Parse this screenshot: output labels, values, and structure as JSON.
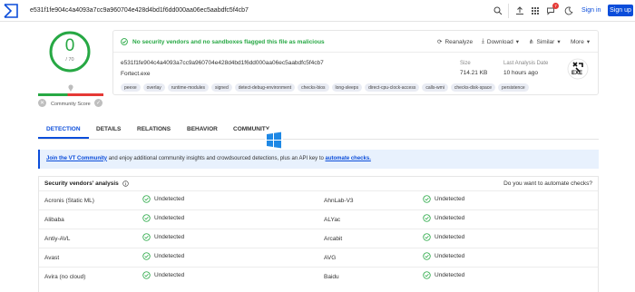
{
  "topbar": {
    "search_value": "e531f1fe904c4a4093a7cc9a960704e428d4bd1f6dd000aa06ec5aabdfc5f4cb7",
    "signin_label": "Sign in",
    "signup_label": "Sign up",
    "notification_count": "7"
  },
  "score": {
    "detected": "0",
    "total": "/ 70",
    "label": "Community Score"
  },
  "summary": {
    "status": "No security vendors and no sandboxes flagged this file as malicious",
    "actions": {
      "reanalyze": "Reanalyze",
      "download": "Download",
      "similar": "Similar",
      "more": "More"
    },
    "hash": "e531f1fe904c4a4093a7cc9a960704e428d4bd1f6dd000aa06ec5aabdfc5f4cb7",
    "filename": "Fortect.exe",
    "tags": [
      "peexe",
      "overlay",
      "runtime-modules",
      "signed",
      "detect-debug-environment",
      "checks-bios",
      "long-sleeps",
      "direct-cpu-clock-access",
      "calls-wmi",
      "checks-disk-space",
      "persistence"
    ],
    "size_label": "Size",
    "size_value": "714.21 KB",
    "last_analysis_label": "Last Analysis Date",
    "last_analysis_value": "10 hours ago",
    "file_type": "EXE"
  },
  "tabs": [
    "DETECTION",
    "DETAILS",
    "RELATIONS",
    "BEHAVIOR",
    "COMMUNITY"
  ],
  "banner": {
    "link1": "Join the VT Community",
    "text": " and enjoy additional community insights and crowdsourced detections, plus an API key to ",
    "link2": "automate checks."
  },
  "vendors": {
    "title": "Security vendors' analysis",
    "automate_prompt": "Do you want to automate checks?",
    "rows": [
      {
        "left": "Acronis (Static ML)",
        "left_result": "Undetected",
        "right": "AhnLab-V3",
        "right_result": "Undetected"
      },
      {
        "left": "Alibaba",
        "left_result": "Undetected",
        "right": "ALYac",
        "right_result": "Undetected"
      },
      {
        "left": "Antiy-AVL",
        "left_result": "Undetected",
        "right": "Arcabit",
        "right_result": "Undetected"
      },
      {
        "left": "Avast",
        "left_result": "Undetected",
        "right": "AVG",
        "right_result": "Undetected"
      },
      {
        "left": "Avira (no cloud)",
        "left_result": "Undetected",
        "right": "Baidu",
        "right_result": "Undetected"
      }
    ]
  },
  "colors": {
    "accent": "#0b4dda",
    "clean": "#27a844",
    "alert": "#e53935"
  }
}
